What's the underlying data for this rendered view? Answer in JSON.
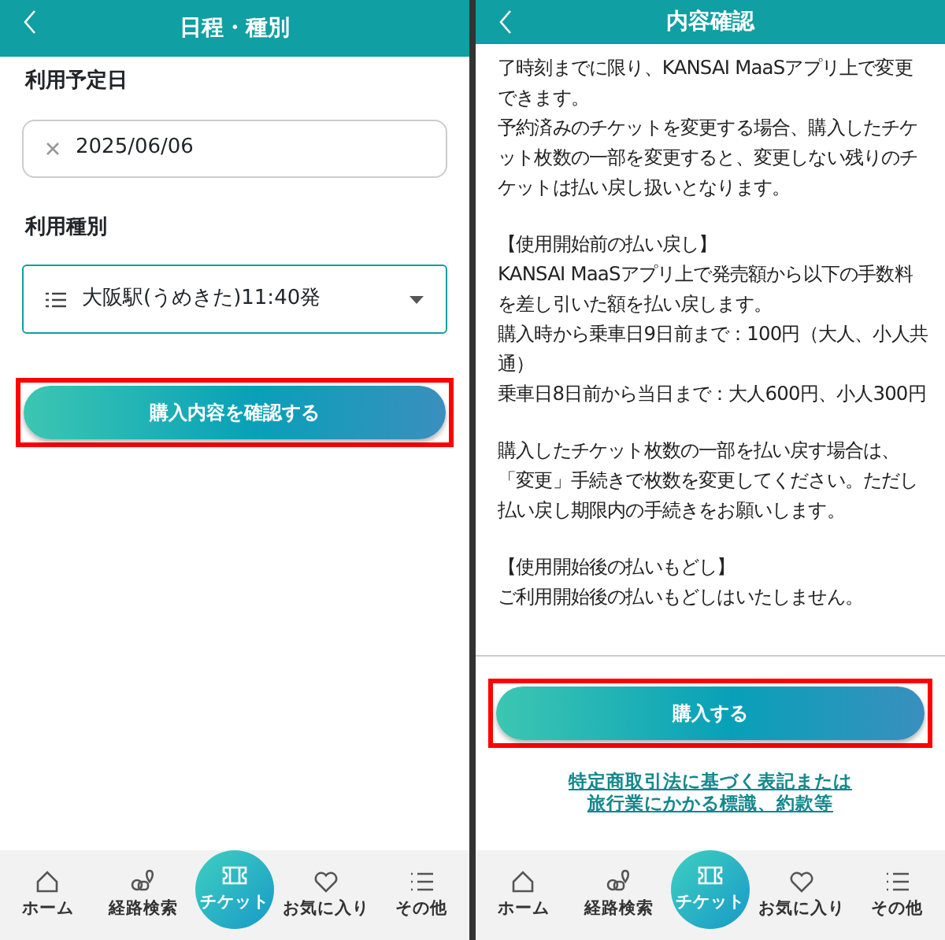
{
  "screens": [
    {
      "kind": "form",
      "title": "日程・種別",
      "fields": [
        {
          "kind": "date",
          "label": "利用予定日",
          "value": "2025/06/06"
        },
        {
          "kind": "select",
          "label": "利用種別",
          "value": "大阪駅(うめきた)11:40発"
        }
      ],
      "button": {
        "label": "購入内容を確認する",
        "highlighted": true
      },
      "nav": [
        {
          "kind": "home",
          "label": "ホーム",
          "selected": false
        },
        {
          "kind": "route",
          "label": "経路検索",
          "selected": false
        },
        {
          "kind": "ticket",
          "label": "チケット",
          "selected": true
        },
        {
          "kind": "heart",
          "label": "お気に入り",
          "selected": false
        },
        {
          "kind": "list",
          "label": "その他",
          "selected": false
        }
      ]
    },
    {
      "kind": "confirm",
      "title": "内容確認",
      "blocks": [
        [
          "了時刻までに限り、KANSAI MaaSアプリ上で変更できます。",
          "予約済みのチケットを変更する場合、購入したチケット枚数の一部を変更すると、変更しない残りのチケットは払い戻し扱いとなります。"
        ],
        [
          "【使用開始前の払い戻し】",
          "KANSAI MaaSアプリ上で発売額から以下の手数料を差し引いた額を払い戻します。",
          "購入時から乗車日9日前まで：100円（大人、小人共通）",
          "乗車日8日前から当日まで：大人600円、小人300円"
        ],
        [
          "購入したチケット枚数の一部を払い戻す場合は、「変更」手続きで枚数を変更してください。ただし払い戻し期限内の手続きをお願いします。"
        ],
        [
          "【使用開始後の払いもどし】",
          "ご利用開始後の払いもどしはいたしません。"
        ]
      ],
      "button": {
        "label": "購入する",
        "highlighted": true
      },
      "link": "特定商取引法に基づく表記または旅行業にかかる標識、約款等",
      "nav": [
        {
          "kind": "home",
          "label": "ホーム",
          "selected": false
        },
        {
          "kind": "route",
          "label": "経路検索",
          "selected": false
        },
        {
          "kind": "ticket",
          "label": "チケット",
          "selected": true
        },
        {
          "kind": "heart",
          "label": "お気に入り",
          "selected": false
        },
        {
          "kind": "list",
          "label": "その他",
          "selected": false
        }
      ]
    }
  ]
}
